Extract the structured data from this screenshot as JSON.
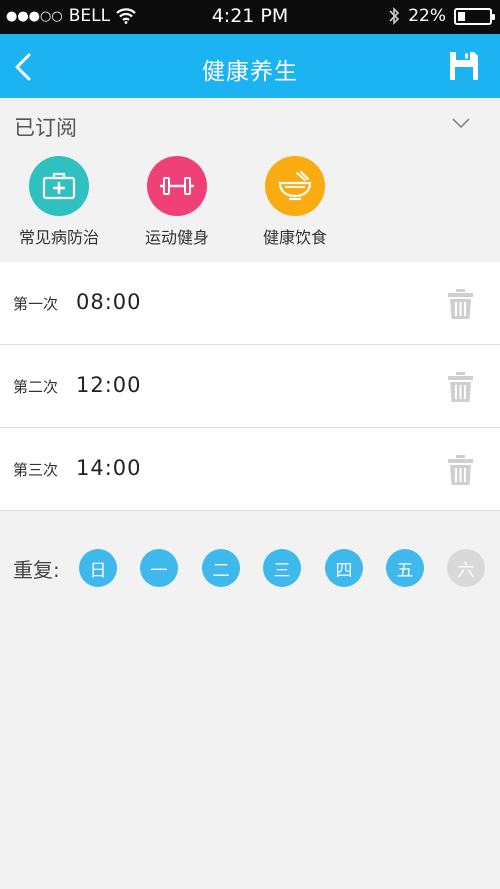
{
  "status_bar": {
    "signal_dots": "●●●○○",
    "carrier": "BELL",
    "time": "4:21 PM",
    "battery_text": "22%",
    "battery_level": 0.22
  },
  "nav": {
    "title": "健康养生"
  },
  "subscribed": {
    "title": "已订阅"
  },
  "categories": [
    {
      "label": "常见病防治",
      "icon": "medical-kit-icon",
      "color": "#2ec1c0"
    },
    {
      "label": "运动健身",
      "icon": "dumbbell-icon",
      "color": "#ef4077"
    },
    {
      "label": "健康饮食",
      "icon": "bowl-icon",
      "color": "#fbab12"
    }
  ],
  "reminders": [
    {
      "label": "第一次",
      "time": "08:00"
    },
    {
      "label": "第二次",
      "time": "12:00"
    },
    {
      "label": "第三次",
      "time": "14:00"
    }
  ],
  "repeat": {
    "label": "重复:",
    "days": [
      {
        "label": "日",
        "selected": true
      },
      {
        "label": "一",
        "selected": true
      },
      {
        "label": "二",
        "selected": true
      },
      {
        "label": "三",
        "selected": true
      },
      {
        "label": "四",
        "selected": true
      },
      {
        "label": "五",
        "selected": true
      },
      {
        "label": "六",
        "selected": false
      }
    ]
  },
  "colors": {
    "accent": "#1bb3f2",
    "day_on": "#3fb8ec",
    "day_off": "#d9d9d9",
    "trash": "#cfcfcf"
  }
}
